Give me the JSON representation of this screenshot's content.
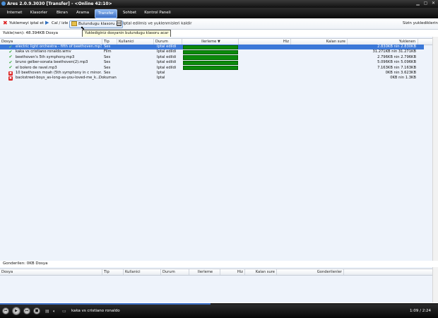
{
  "window": {
    "title": "Ares 2.0.9.3030  [Transfer]  - <Online 42:10>"
  },
  "menu": {
    "tabs": [
      {
        "label": "Internet"
      },
      {
        "label": "Klasorler"
      },
      {
        "label": "Bkran"
      },
      {
        "label": "Arama"
      },
      {
        "label": "Transfer",
        "active": true
      },
      {
        "label": "Sohbet"
      },
      {
        "label": "Kontrol Paneli"
      }
    ]
  },
  "toolbar": {
    "cancel_label": "Yuklemeyi iptal et",
    "play_label": "Cal / izle",
    "open_folder_label": "Bulundugu klasoru ac",
    "clear_label": "Iptal edilmis ve yuklenmisleri kaldir",
    "right_label": "Sizin yukledikleriniz"
  },
  "tooltip": {
    "text": "Yuklediginiz dosyanin bulundugu klasoru acar"
  },
  "uploads": {
    "summary": "Yukle(nen): 48.394KB Dosya",
    "columns": {
      "file": "Dosya",
      "type": "Tip",
      "user": "Kullanici",
      "status": "Durum",
      "progress": "Ilerleme",
      "speed": "Hiz",
      "remaining": "Kalan sure",
      "uploaded": "Yuklenen"
    },
    "rows": [
      {
        "name": "electric light orchestra - fifth of beethoven.mp3",
        "type": "Ses",
        "status": "Iptal edildi",
        "progress": 1.0,
        "uploaded": "2.830KB nin 2.830KB",
        "ok": true
      },
      {
        "name": "kaka vs cristiano ronaldo.wmv",
        "type": "Film",
        "status": "Iptal edildi",
        "progress": 1.0,
        "uploaded": "31.271KB nin 31.271KB",
        "ok": true
      },
      {
        "name": "beethoven's 5th symphony.mp3",
        "type": "Ses",
        "status": "Iptal edildi",
        "progress": 1.0,
        "uploaded": "2.796KB nin 2.796KB",
        "ok": true
      },
      {
        "name": "bruno gelber-sonata beethoven(2).mp3",
        "type": "Ses",
        "status": "Iptal edildi",
        "progress": 1.0,
        "uploaded": "5.096KB nin 5.096KB",
        "ok": true
      },
      {
        "name": "el bolero de ravel.mp3",
        "type": "Ses",
        "status": "Iptal edildi",
        "progress": 1.0,
        "uploaded": "7.163KB nin 7.163KB",
        "ok": true
      },
      {
        "name": "10 beethoven moah (5th symphony in c minor...",
        "type": "Ses",
        "status": "Iptal",
        "progress": 0,
        "uploaded": "0KB nin 3.623KB",
        "ok": false
      },
      {
        "name": "backstreet-boys_as-long-as-you-loved-me_k...",
        "type": "Dokuman",
        "status": "Iptal",
        "progress": 0,
        "uploaded": "0KB nin 1.3KB",
        "ok": false
      }
    ]
  },
  "downloads": {
    "summary": "Gonderilen: 0KB Dosya",
    "columns": {
      "file": "Dosya",
      "type": "Tip",
      "user": "Kullanici",
      "status": "Durum",
      "progress": "Ilerleme",
      "speed": "Hiz",
      "remaining": "Kalan sure",
      "sent": "Gonderilenler"
    }
  },
  "player": {
    "track": "kaka vs cristiano ronaldo",
    "time": "1:09 / 2:24",
    "position_fraction": 0.48
  },
  "colors": {
    "selection": "#3b78d8",
    "progress": "#0a8a0a",
    "accent": "#3d6fc6"
  }
}
